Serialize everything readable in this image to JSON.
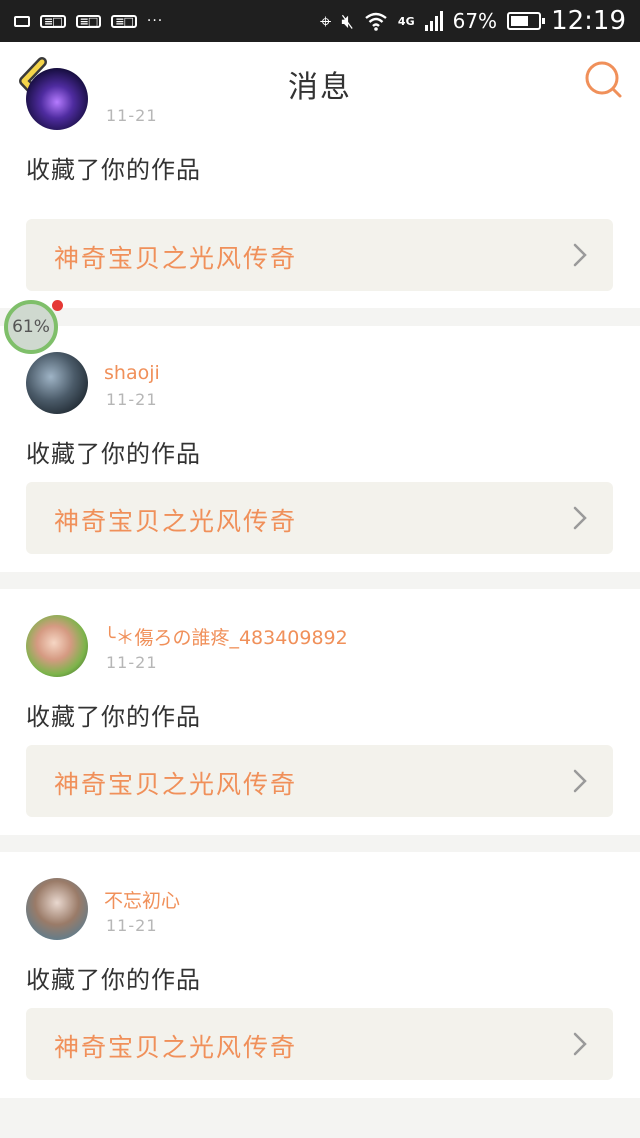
{
  "status_bar": {
    "dots": "···",
    "network": "4G",
    "battery_percent": "67%",
    "battery_level": 0.67,
    "time": "12:19",
    "icons": [
      "image-icon",
      "notification-icon",
      "notification-icon",
      "notification-icon",
      "location-icon",
      "mute-icon",
      "wifi-icon",
      "signal-icon",
      "battery-icon"
    ]
  },
  "header": {
    "title": "消息",
    "back_icon": "chevron-left-icon",
    "search_icon": "search-icon",
    "accent_color": "#f0905a"
  },
  "floating_bubble": {
    "label": "61%"
  },
  "messages": [
    {
      "username": "",
      "date": "11-21",
      "text": "收藏了你的作品",
      "work_title": "神奇宝贝之光风传奇"
    },
    {
      "username": "shaoji",
      "date": "11-21",
      "text": "收藏了你的作品",
      "work_title": "神奇宝贝之光风传奇"
    },
    {
      "username": "╰＊傷ろの誰疼_483409892",
      "date": "11-21",
      "text": "收藏了你的作品",
      "work_title": "神奇宝贝之光风传奇"
    },
    {
      "username": "不忘初心",
      "date": "11-21",
      "text": "收藏了你的作品",
      "work_title": "神奇宝贝之光风传奇"
    }
  ]
}
